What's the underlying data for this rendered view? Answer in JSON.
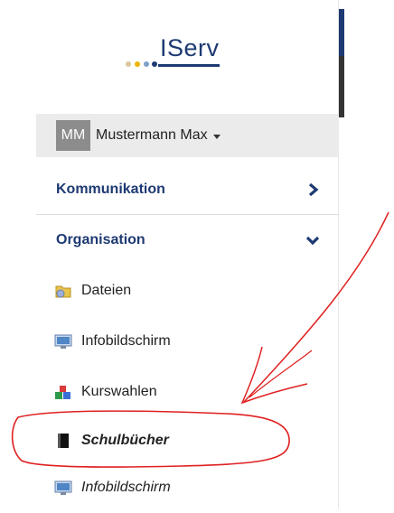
{
  "logo": {
    "text": "IServ"
  },
  "user": {
    "initials": "MM",
    "name": "Mustermann Max"
  },
  "sections": {
    "kommunikation": "Kommunikation",
    "organisation": "Organisation"
  },
  "items": [
    {
      "label": "Dateien",
      "icon": "folder-icon"
    },
    {
      "label": "Infobildschirm",
      "icon": "monitor-icon"
    },
    {
      "label": "Kurswahlen",
      "icon": "blocks-icon"
    },
    {
      "label": "Schulbücher",
      "icon": "book-icon"
    },
    {
      "label": "Infobildschirm",
      "icon": "monitor-icon"
    }
  ],
  "colors": {
    "brand": "#1e3a73",
    "annotation": "#e02020"
  }
}
